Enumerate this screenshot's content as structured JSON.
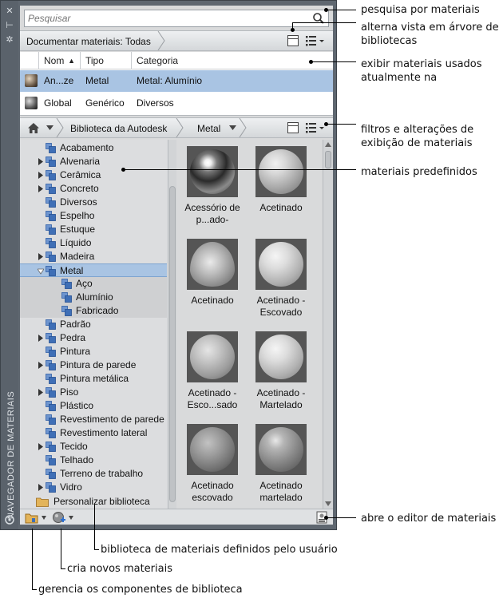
{
  "panel": {
    "title": "NAVEGADOR DE MATERIAIS",
    "close_glyph": "✕",
    "pin_glyph": "⊢",
    "props_glyph": "✲"
  },
  "search": {
    "placeholder": "Pesquisar",
    "icon": "search-icon"
  },
  "document_bar": {
    "label": "Documentar materiais: Todas"
  },
  "doc_table": {
    "columns": [
      "Nom",
      "Tipo",
      "Categoria"
    ],
    "sort_indicator": "▲",
    "rows": [
      {
        "name": "An...ze",
        "type": "Metal",
        "category": "Metal: Alumínio",
        "selected": true
      },
      {
        "name": "Global",
        "type": "Genérico",
        "category": "Diversos",
        "selected": false
      }
    ]
  },
  "library_bar": {
    "home_icon": "home-icon",
    "library": "Biblioteca da Autodesk",
    "folder": "Metal"
  },
  "tree": {
    "items": [
      {
        "label": "Acabamento",
        "expandable": false,
        "level": 0
      },
      {
        "label": "Alvenaria",
        "expandable": true,
        "level": 0
      },
      {
        "label": "Cerâmica",
        "expandable": true,
        "level": 0
      },
      {
        "label": "Concreto",
        "expandable": true,
        "level": 0
      },
      {
        "label": "Diversos",
        "expandable": false,
        "level": 0
      },
      {
        "label": "Espelho",
        "expandable": false,
        "level": 0
      },
      {
        "label": "Estuque",
        "expandable": false,
        "level": 0
      },
      {
        "label": "Líquido",
        "expandable": false,
        "level": 0
      },
      {
        "label": "Madeira",
        "expandable": true,
        "level": 0
      },
      {
        "label": "Metal",
        "expandable": true,
        "expanded": true,
        "selected": true,
        "level": 0
      },
      {
        "label": "Aço",
        "expandable": false,
        "level": 1
      },
      {
        "label": "Alumínio",
        "expandable": false,
        "level": 1
      },
      {
        "label": "Fabricado",
        "expandable": false,
        "level": 1
      },
      {
        "label": "Padrão",
        "expandable": false,
        "level": 0
      },
      {
        "label": "Pedra",
        "expandable": true,
        "level": 0
      },
      {
        "label": "Pintura",
        "expandable": false,
        "level": 0
      },
      {
        "label": "Pintura de parede",
        "expandable": true,
        "level": 0
      },
      {
        "label": "Pintura metálica",
        "expandable": false,
        "level": 0
      },
      {
        "label": "Piso",
        "expandable": true,
        "level": 0
      },
      {
        "label": "Plástico",
        "expandable": false,
        "level": 0
      },
      {
        "label": "Revestimento de parede",
        "expandable": false,
        "level": 0
      },
      {
        "label": "Revestimento lateral",
        "expandable": false,
        "level": 0
      },
      {
        "label": "Tecido",
        "expandable": true,
        "level": 0
      },
      {
        "label": "Telhado",
        "expandable": false,
        "level": 0
      },
      {
        "label": "Terreno de trabalho",
        "expandable": false,
        "level": 0
      },
      {
        "label": "Vidro",
        "expandable": true,
        "level": 0
      }
    ],
    "custom_library": "Personalizar biblioteca"
  },
  "materials": [
    {
      "label": "Acessório de p...ado-",
      "style": "chrome"
    },
    {
      "label": "Acetinado",
      "style": "satin"
    },
    {
      "label": "Acetinado",
      "style": "cone"
    },
    {
      "label": "Acetinado - Escovado",
      "style": "satin-light"
    },
    {
      "label": "Acetinado - Esco...sado",
      "style": "rough"
    },
    {
      "label": "Acetinado - Martelado",
      "style": "satin-light"
    },
    {
      "label": "Acetinado escovado",
      "style": "dark-rough"
    },
    {
      "label": "Acetinado martelado",
      "style": "dark-gloss"
    }
  ],
  "callouts": {
    "search": "pesquisa por materiais",
    "tree_toggle": "alterna vista em árvore de bibliotecas",
    "in_use": "exibir materiais usados atualmente na",
    "filters": "filtros e alterações de exibição de materiais",
    "predefined": "materiais predefinidos",
    "editor": "abre o editor de materiais",
    "user_lib": "biblioteca de materiais definidos pelo usuário",
    "create": "cria novos materiais",
    "manage": "gerencia os componentes de biblioteca"
  },
  "colors": {
    "panel": "#5f6770",
    "content": "#d9dadb",
    "selection": "#a9c4e3",
    "folder_blue": "#3f6fb6"
  }
}
